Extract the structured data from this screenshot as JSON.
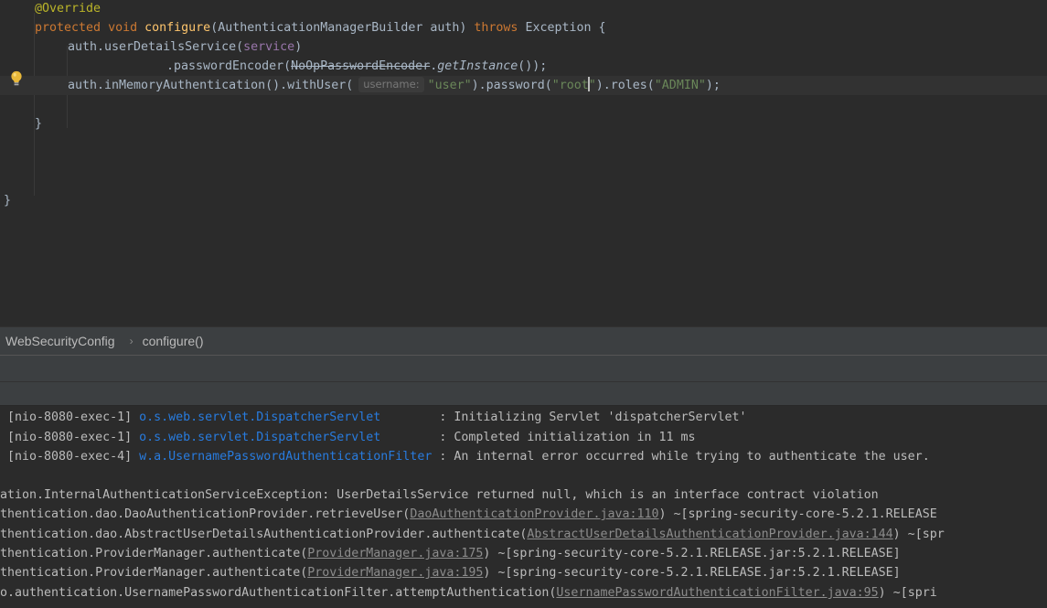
{
  "editor": {
    "line1": {
      "annotation": "@Override"
    },
    "line2": {
      "kw_protected": "protected",
      "kw_void": "void",
      "method": "configure",
      "params": "(AuthenticationManagerBuilder auth)",
      "kw_throws": "throws",
      "exception": "Exception {"
    },
    "line3": {
      "prefix": "auth.userDetailsService(",
      "field": "service",
      "suffix": ")"
    },
    "line4": {
      "prefix": ".passwordEncoder(",
      "strike_class": "NoOpPasswordEncoder",
      "dot": ".",
      "static_call": "getInstance",
      "suffix": "());"
    },
    "line5": {
      "prefix": "auth.inMemoryAuthentication().withUser(",
      "hint": "username:",
      "str_user": "\"user\"",
      "mid1": ").password(",
      "str_root_a": "\"root",
      "str_root_b": "\"",
      "mid2": ").roles(",
      "str_admin": "\"ADMIN\"",
      "suffix": ");"
    },
    "line7": {
      "text": "}"
    },
    "line11": {
      "text": "}"
    }
  },
  "breadcrumb": {
    "items": [
      {
        "label": "WebSecurityConfig"
      },
      {
        "label": "configure()"
      }
    ],
    "separator": "›"
  },
  "console": {
    "lines": [
      {
        "thread": " [nio-8080-exec-1] ",
        "logger": "o.s.web.servlet.DispatcherServlet       ",
        "message": " : Initializing Servlet 'dispatcherServlet'"
      },
      {
        "thread": " [nio-8080-exec-1] ",
        "logger": "o.s.web.servlet.DispatcherServlet       ",
        "message": " : Completed initialization in 11 ms"
      },
      {
        "thread": " [nio-8080-exec-4] ",
        "logger": "w.a.UsernamePasswordAuthenticationFilter",
        "message": " : An internal error occurred while trying to authenticate the user."
      }
    ],
    "exception_line": "ation.InternalAuthenticationServiceException: UserDetailsService returned null, which is an interface contract violation",
    "stack": [
      {
        "prefix": "thentication.dao.DaoAuthenticationProvider.retrieveUser(",
        "link": "DaoAuthenticationProvider.java:110",
        "suffix": ") ~[spring-security-core-5.2.1.RELEASE"
      },
      {
        "prefix": "thentication.dao.AbstractUserDetailsAuthenticationProvider.authenticate(",
        "link": "AbstractUserDetailsAuthenticationProvider.java:144",
        "suffix": ") ~[spr"
      },
      {
        "prefix": "thentication.ProviderManager.authenticate(",
        "link": "ProviderManager.java:175",
        "suffix": ") ~[spring-security-core-5.2.1.RELEASE.jar:5.2.1.RELEASE]"
      },
      {
        "prefix": "thentication.ProviderManager.authenticate(",
        "link": "ProviderManager.java:195",
        "suffix": ") ~[spring-security-core-5.2.1.RELEASE.jar:5.2.1.RELEASE]"
      },
      {
        "prefix": "o.authentication.UsernamePasswordAuthenticationFilter.attemptAuthentication(",
        "link": "UsernamePasswordAuthenticationFilter.java:95",
        "suffix": ") ~[spri"
      }
    ]
  },
  "colors": {
    "editor_bg": "#2b2b2b",
    "keyword": "#cc7832",
    "annotation": "#bbb529",
    "method": "#ffc66d",
    "field": "#9876aa",
    "string": "#6a8759",
    "log_class": "#287bde",
    "link": "#8c8c8c"
  },
  "icons": {
    "intention": "lightbulb-icon"
  }
}
